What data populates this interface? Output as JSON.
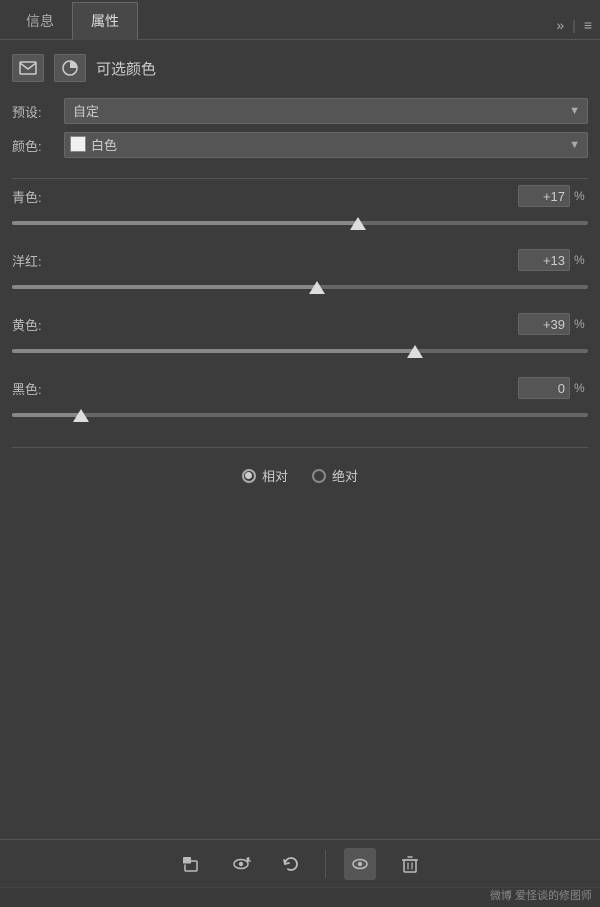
{
  "tabs": {
    "info": {
      "label": "信息",
      "active": false
    },
    "properties": {
      "label": "属性",
      "active": true
    }
  },
  "tab_actions": {
    "expand": "»",
    "menu": "≡"
  },
  "header": {
    "title": "可选颜色"
  },
  "preset": {
    "label": "预设:",
    "value": "自定",
    "options": [
      "自定"
    ]
  },
  "color": {
    "label": "颜色:",
    "swatch_color": "#f0f0f0",
    "value": "白色",
    "options": [
      "白色"
    ]
  },
  "sliders": [
    {
      "id": "cyan",
      "label": "青色:",
      "value": "+17",
      "unit": "%",
      "fill_pct": 60
    },
    {
      "id": "magenta",
      "label": "洋红:",
      "value": "+13",
      "unit": "%",
      "fill_pct": 53
    },
    {
      "id": "yellow",
      "label": "黄色:",
      "value": "+39",
      "unit": "%",
      "fill_pct": 70
    },
    {
      "id": "black",
      "label": "黑色:",
      "value": "0",
      "unit": "%",
      "fill_pct": 12
    }
  ],
  "radio": {
    "option1": {
      "label": "相对",
      "checked": true
    },
    "option2": {
      "label": "绝对",
      "checked": false
    }
  },
  "toolbar": {
    "clip_icon": "clip",
    "eye_cycle_icon": "eye-cycle",
    "reset_icon": "reset",
    "visibility_icon": "visibility",
    "delete_icon": "delete"
  },
  "watermark": "微博 爱怪谈的修图师"
}
